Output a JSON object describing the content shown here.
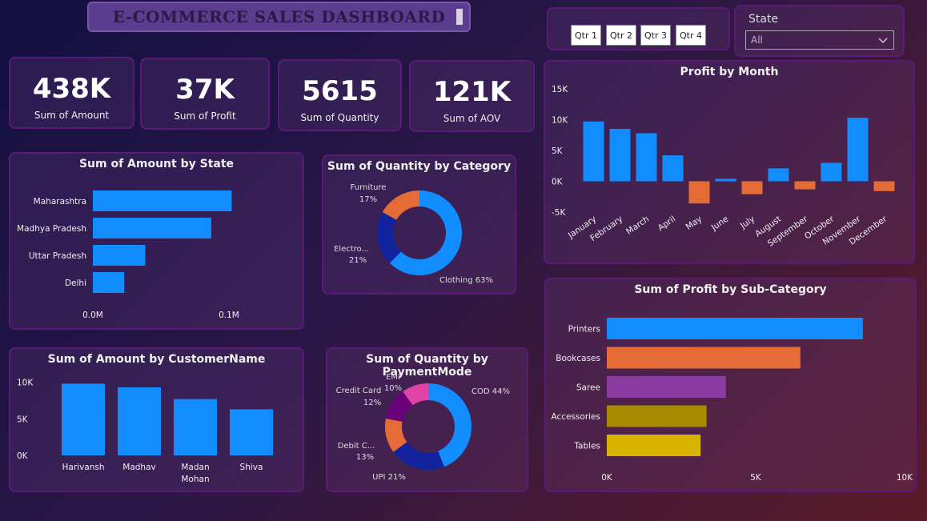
{
  "header": {
    "title": "E-COMMERCE SALES DASHBOARD"
  },
  "filters": {
    "quarters": [
      "Qtr 1",
      "Qtr 2",
      "Qtr 3",
      "Qtr 4"
    ],
    "state_label": "State",
    "state_value": "All"
  },
  "kpis": [
    {
      "value": "438K",
      "label": "Sum of Amount"
    },
    {
      "value": "37K",
      "label": "Sum of Profit"
    },
    {
      "value": "5615",
      "label": "Sum of Quantity"
    },
    {
      "value": "121K",
      "label": "Sum of AOV"
    }
  ],
  "chart_data": [
    {
      "id": "amount_by_state",
      "type": "bar",
      "orientation": "horizontal",
      "title": "Sum of Amount by State",
      "categories": [
        "Maharashtra",
        "Madhya Pradesh",
        "Uttar Pradesh",
        "Delhi"
      ],
      "values": [
        102000,
        87000,
        38500,
        23000
      ],
      "xlim": [
        0,
        120000
      ],
      "ticks": [
        {
          "value": 0,
          "label": "0.0M"
        },
        {
          "value": 100000,
          "label": "0.1M"
        }
      ],
      "colors": [
        "#118DFF"
      ]
    },
    {
      "id": "quantity_by_category",
      "type": "pie",
      "donut": true,
      "title": "Sum of Quantity by Category",
      "categories": [
        "Clothing",
        "Electro...",
        "Furniture"
      ],
      "values": [
        63,
        21,
        17
      ],
      "labels": [
        "Clothing 63%",
        "21%",
        "17%"
      ],
      "colors": [
        "#118DFF",
        "#12239E",
        "#E66C37"
      ]
    },
    {
      "id": "profit_by_month",
      "type": "bar",
      "title": "Profit by Month",
      "categories": [
        "January",
        "February",
        "March",
        "April",
        "May",
        "June",
        "July",
        "August",
        "September",
        "October",
        "November",
        "December"
      ],
      "values": [
        9700,
        8500,
        7800,
        4200,
        -3600,
        400,
        -2100,
        2100,
        -1300,
        3000,
        10300,
        -1600
      ],
      "ylim": [
        -5000,
        15000
      ],
      "ticks": [
        {
          "value": 15000,
          "label": "15K"
        },
        {
          "value": 10000,
          "label": "10K"
        },
        {
          "value": 5000,
          "label": "5K"
        },
        {
          "value": 0,
          "label": "0K"
        },
        {
          "value": -5000,
          "label": "-5K"
        }
      ],
      "colors": {
        "positive": "#118DFF",
        "negative": "#E66C37"
      }
    },
    {
      "id": "amount_by_customer",
      "type": "bar",
      "title": "Sum of Amount by CustomerName",
      "categories": [
        "Harivansh",
        "Madhav",
        "Madan Mohan",
        "Shiva"
      ],
      "values": [
        9800,
        9300,
        7700,
        6300
      ],
      "ylim": [
        0,
        10500
      ],
      "ticks": [
        {
          "value": 10000,
          "label": "10K"
        },
        {
          "value": 5000,
          "label": "5K"
        },
        {
          "value": 0,
          "label": "0K"
        }
      ],
      "colors": [
        "#118DFF"
      ]
    },
    {
      "id": "quantity_by_paymentmode",
      "type": "pie",
      "donut": true,
      "title": "Sum of Quantity by PaymentMode",
      "categories": [
        "COD",
        "UPI",
        "Debit Card",
        "Credit Card",
        "EMI"
      ],
      "values": [
        44,
        21,
        13,
        12,
        10
      ],
      "colors": [
        "#118DFF",
        "#12239E",
        "#E66C37",
        "#6B007B",
        "#E044A7"
      ]
    },
    {
      "id": "profit_by_subcategory",
      "type": "bar",
      "orientation": "horizontal",
      "title": "Sum of Profit by Sub-Category",
      "categories": [
        "Printers",
        "Bookcases",
        "Saree",
        "Accessories",
        "Tables"
      ],
      "values": [
        8600,
        6500,
        4000,
        3350,
        3150
      ],
      "xlim": [
        0,
        10000
      ],
      "ticks": [
        {
          "value": 0,
          "label": "0K"
        },
        {
          "value": 5000,
          "label": "5K"
        },
        {
          "value": 10000,
          "label": "10K"
        }
      ],
      "colors": [
        "#118DFF",
        "#E66C37",
        "#8B3CA0",
        "#A88B00",
        "#D9B300"
      ]
    }
  ],
  "donut_labels": {
    "category": {
      "furniture_name": "Furniture",
      "furniture_pct": "17%",
      "electro_name": "Electro...",
      "electro_pct": "21%",
      "clothing": "Clothing 63%"
    },
    "payment": {
      "cod": "COD 44%",
      "upi": "UPI 21%",
      "debit_name": "Debit C...",
      "debit_pct": "13%",
      "credit_name": "Credit Card",
      "credit_pct": "12%",
      "emi_name": "EMI",
      "emi_pct": "10%"
    }
  }
}
